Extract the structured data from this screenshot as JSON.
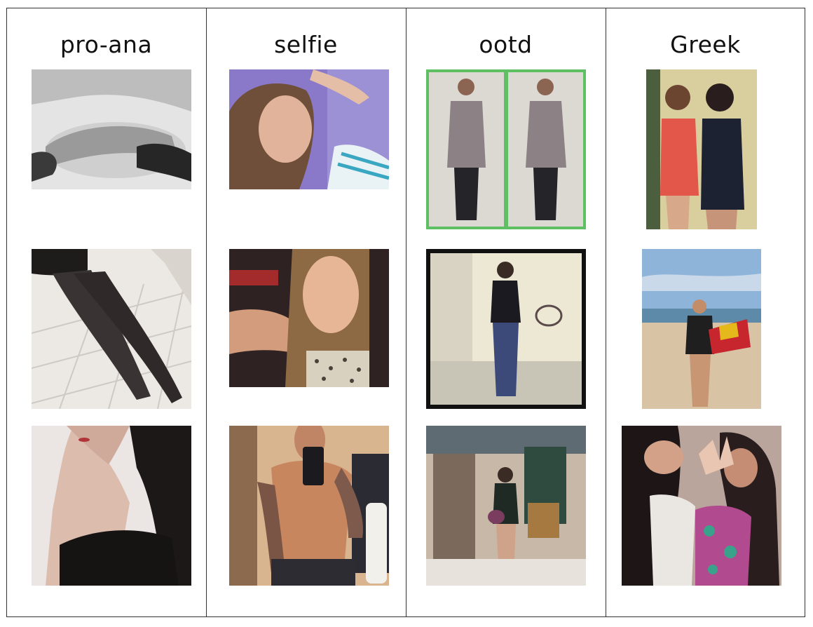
{
  "columns": [
    {
      "title": "pro-ana",
      "images": [
        {
          "subject": "reclining torso on bed, black and white",
          "palette": [
            "#dcdcdc",
            "#8a8a8a",
            "#2a2a2a"
          ]
        },
        {
          "subject": "legs in black tights on tiled floor",
          "palette": [
            "#e9e6e2",
            "#b7b1ab",
            "#2e2a2a"
          ]
        },
        {
          "subject": "woman in black camisole, dark hair",
          "palette": [
            "#efe9e6",
            "#d7b9a9",
            "#1e1a1a"
          ]
        }
      ]
    },
    {
      "title": "selfie",
      "images": [
        {
          "subject": "smiling girl lying on purple blanket",
          "palette": [
            "#8a79c9",
            "#c79a83",
            "#7b5b44"
          ]
        },
        {
          "subject": "smiling girl with long wavy hair",
          "palette": [
            "#3a2a26",
            "#c89474",
            "#8b6a45"
          ]
        },
        {
          "subject": "shirtless tattooed man mirror selfie",
          "palette": [
            "#d8b48f",
            "#b27a5a",
            "#2a2326"
          ]
        }
      ]
    },
    {
      "title": "ootd",
      "images": [
        {
          "subject": "two photos of man in grey suit, green border",
          "palette": [
            "#5fbf63",
            "#9b8f8b",
            "#2b2a30"
          ]
        },
        {
          "subject": "woman in black top and jeans, black frame",
          "palette": [
            "#111111",
            "#ece8d4",
            "#3b4a78"
          ]
        },
        {
          "subject": "woman mirror selfie in clothing store",
          "palette": [
            "#7b6a5b",
            "#2f4a3e",
            "#c8b8a8"
          ]
        }
      ]
    },
    {
      "title": "Greek",
      "images": [
        {
          "subject": "two women in red and black dresses",
          "palette": [
            "#d9cf9e",
            "#e2574a",
            "#1d2233"
          ]
        },
        {
          "subject": "woman on beach holding Maryland flag",
          "palette": [
            "#8fb4d9",
            "#d8c3a5",
            "#1f1f1f"
          ]
        },
        {
          "subject": "two women posing with hand signs",
          "palette": [
            "#2a1d1d",
            "#d8a08a",
            "#b14a8e"
          ]
        }
      ]
    }
  ]
}
